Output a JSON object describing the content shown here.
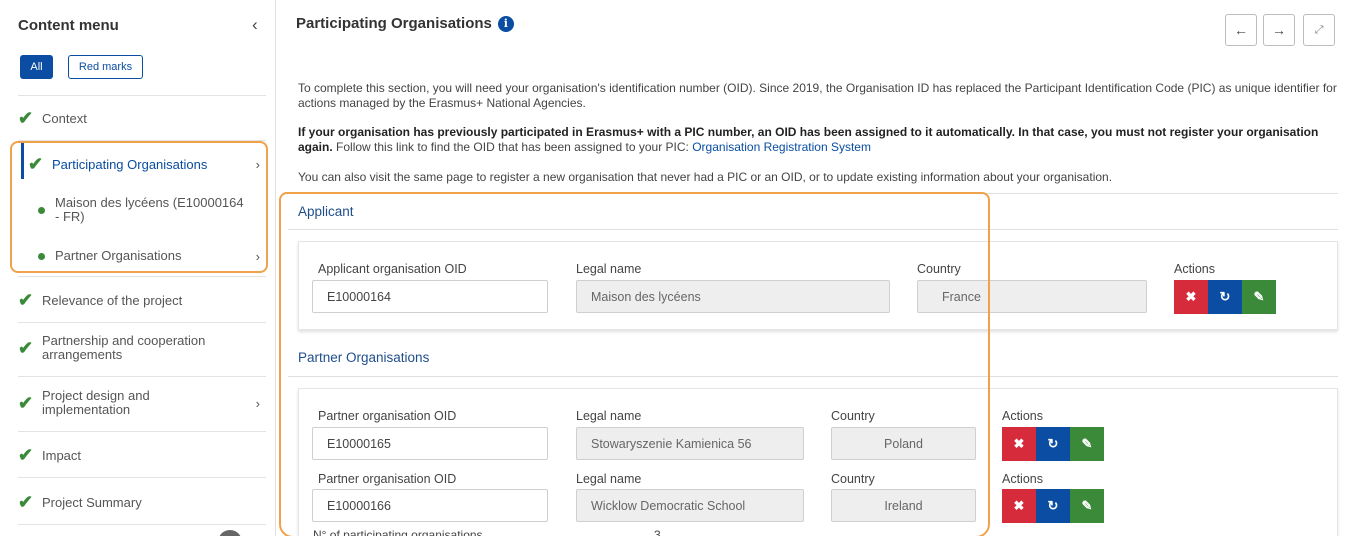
{
  "sidebar": {
    "title": "Content menu",
    "collapse_icon": "chevron-left-icon",
    "filter_all": "All",
    "filter_red": "Red marks",
    "items": [
      {
        "label": "Context"
      },
      {
        "label": "Participating Organisations"
      },
      {
        "label": "Maison des lycéens (E10000164 - FR)"
      },
      {
        "label": "Partner Organisations"
      },
      {
        "label": "Relevance of the project"
      },
      {
        "label": "Partnership and cooperation arrangements"
      },
      {
        "label": "Project design and implementation"
      },
      {
        "label": "Impact"
      },
      {
        "label": "Project Summary"
      }
    ]
  },
  "main": {
    "title": "Participating Organisations",
    "intro1": "To complete this section, you will need your organisation's identification number (OID). Since 2019, the Organisation ID has replaced the Participant Identification Code (PIC) as unique identifier for actions managed by the Erasmus+ National Agencies.",
    "intro2_bold": "If your organisation has previously participated in Erasmus+ with a PIC number, an OID has been assigned to it automatically. In that case, you must not register your organisation again.",
    "intro2_rest": " Follow this link to find the OID that has been assigned to your PIC: ",
    "intro2_link": "Organisation Registration System",
    "intro3": "You can also visit the same page to register a new organisation that never had a PIC or an OID, or to update existing information about your organisation.",
    "applicant": {
      "heading": "Applicant",
      "oid_label": "Applicant organisation OID",
      "oid": "E10000164",
      "legal_label": "Legal name",
      "legal_name": "Maison des lycéens",
      "country_label": "Country",
      "country": "France",
      "actions_label": "Actions"
    },
    "partners": {
      "heading": "Partner Organisations",
      "rows": [
        {
          "oid_label": "Partner organisation OID",
          "oid": "E10000165",
          "legal_label": "Legal name",
          "legal_name": "Stowaryszenie Kamienica 56",
          "country_label": "Country",
          "country": "Poland",
          "actions_label": "Actions"
        },
        {
          "oid_label": "Partner organisation OID",
          "oid": "E10000166",
          "legal_label": "Legal name",
          "legal_name": "Wicklow Democratic School",
          "country_label": "Country",
          "country": "Ireland",
          "actions_label": "Actions"
        }
      ],
      "count_label": "N° of participating organisations",
      "count": "3"
    }
  },
  "colors": {
    "primary": "#0a4da2",
    "success": "#3a8a3a",
    "danger": "#d52b3a",
    "highlight": "#f0a24a"
  }
}
